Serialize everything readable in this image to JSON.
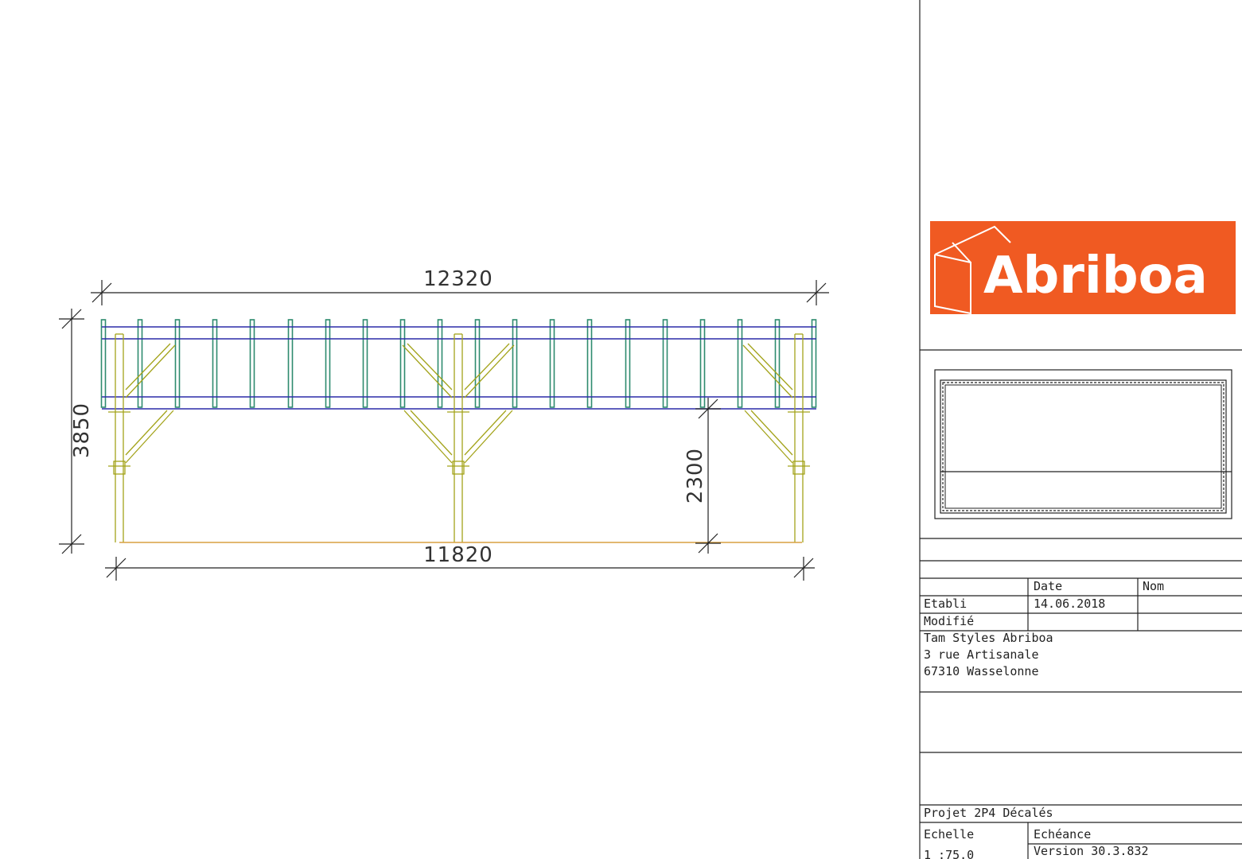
{
  "drawing": {
    "dimensions": {
      "overall_length": "12320",
      "post_span": "11820",
      "total_height": "3850",
      "clear_height": "2300"
    }
  },
  "logo": {
    "text": "Abriboa",
    "background_color": "#f05a22",
    "text_color": "#ffffff"
  },
  "title_block": {
    "header": {
      "date_label": "Date",
      "name_label": "Nom"
    },
    "etabli": {
      "label": "Etabli",
      "date": "14.06.2018",
      "name": ""
    },
    "modifie": {
      "label": "Modifié",
      "date": "",
      "name": ""
    },
    "address": [
      "Tam Styles Abriboa",
      "3 rue Artisanale",
      "67310 Wasselonne"
    ],
    "project": "Projet 2P4 Décalés",
    "echelle_label": "Echelle",
    "echelle_value": "1 :75.0",
    "echeance_label": "Echéance",
    "version": "Version 30.3.832"
  },
  "colors": {
    "rafter": "#2e8b6e",
    "beam": "#2c2ca8",
    "post": "#a3a31a",
    "ground": "#d9a040",
    "dimension": "#222222"
  }
}
